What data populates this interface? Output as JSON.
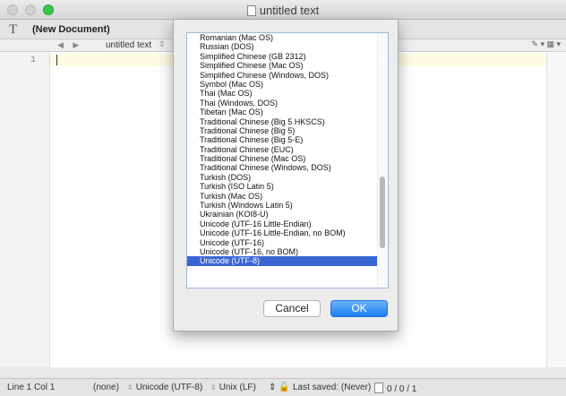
{
  "window": {
    "title": "untitled text"
  },
  "document_bar": {
    "t_icon": "T",
    "name": "(New Document)"
  },
  "nav_bar": {
    "arrows": "◀ ▶",
    "file": "untitled text",
    "stepper": "⇕",
    "right_icons": "✎ ▾ ▦ ▾"
  },
  "editor": {
    "line_number": "1"
  },
  "status_bar": {
    "position": "Line 1 Col 1",
    "language": "(none)",
    "encoding": "Unicode (UTF-8)",
    "line_endings": "Unix (LF)",
    "last_saved": "Last saved: (Never)",
    "counts": "0 / 0 / 1"
  },
  "encoding_sheet": {
    "items": [
      "Romanian (Mac OS)",
      "Russian (DOS)",
      "Simplified Chinese (GB 2312)",
      "Simplified Chinese (Mac OS)",
      "Simplified Chinese (Windows, DOS)",
      "Symbol (Mac OS)",
      "Thai (Mac OS)",
      "Thai (Windows, DOS)",
      "Tibetan (Mac OS)",
      "Traditional Chinese (Big 5 HKSCS)",
      "Traditional Chinese (Big 5)",
      "Traditional Chinese (Big 5-E)",
      "Traditional Chinese (EUC)",
      "Traditional Chinese (Mac OS)",
      "Traditional Chinese (Windows, DOS)",
      "Turkish (DOS)",
      "Turkish (ISO Latin 5)",
      "Turkish (Mac OS)",
      "Turkish (Windows Latin 5)",
      "Ukrainian (KOI8-U)",
      "Unicode (UTF-16 Little-Endian)",
      "Unicode (UTF-16 Little-Endian, no BOM)",
      "Unicode (UTF-16)",
      "Unicode (UTF-16, no BOM)",
      "Unicode (UTF-8)"
    ],
    "selected": "Unicode (UTF-8)",
    "cancel_label": "Cancel",
    "ok_label": "OK"
  },
  "colors": {
    "selection": "#3a66d4",
    "ok_button": "#1b7ff5",
    "current_line": "#fdfbe2"
  }
}
